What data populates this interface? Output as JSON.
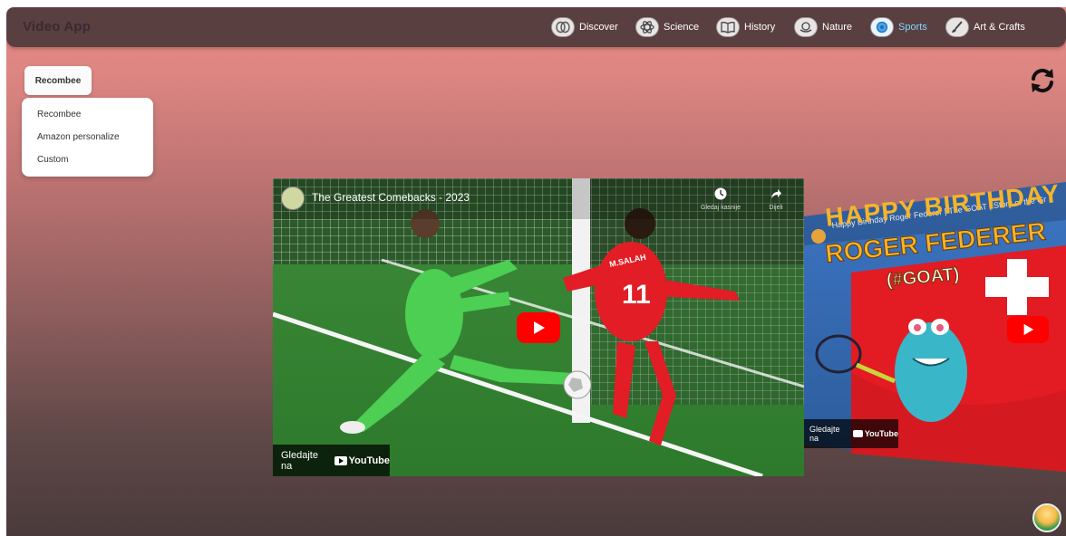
{
  "app": {
    "title": "Video App"
  },
  "nav": {
    "items": [
      {
        "label": "Discover",
        "icon": "brain-icon"
      },
      {
        "label": "Science",
        "icon": "atom-icon"
      },
      {
        "label": "History",
        "icon": "book-icon"
      },
      {
        "label": "Nature",
        "icon": "globe-hands-icon"
      },
      {
        "label": "Sports",
        "icon": "ball-icon",
        "active": true
      },
      {
        "label": "Art & Crafts",
        "icon": "brush-icon"
      }
    ]
  },
  "recommender": {
    "selected": "Recombee",
    "options": [
      "Recombee",
      "Amazon personalize",
      "Custom"
    ]
  },
  "main_video": {
    "title": "The Greatest Comebacks - 2023",
    "watch_later": "Gledaj kasnije",
    "share": "Dijeli",
    "watch_on": "Gledajte na",
    "youtube": "YouTube",
    "player_number": "11",
    "player_name": "M.SALAH"
  },
  "side_video": {
    "title": "Happy Birthday Roger Federer | The GOAT | Story of the Gr",
    "banner_line1": "HAPPY BIRTHDAY",
    "banner_line2": "ROGER FEDERER",
    "banner_line3": "(#GOAT)",
    "watch_on": "Gledajte na",
    "youtube": "YouTube"
  },
  "colors": {
    "navbar": "#5a3f40",
    "active_nav": "#7fd7ff",
    "youtube_red": "#ff0000"
  }
}
